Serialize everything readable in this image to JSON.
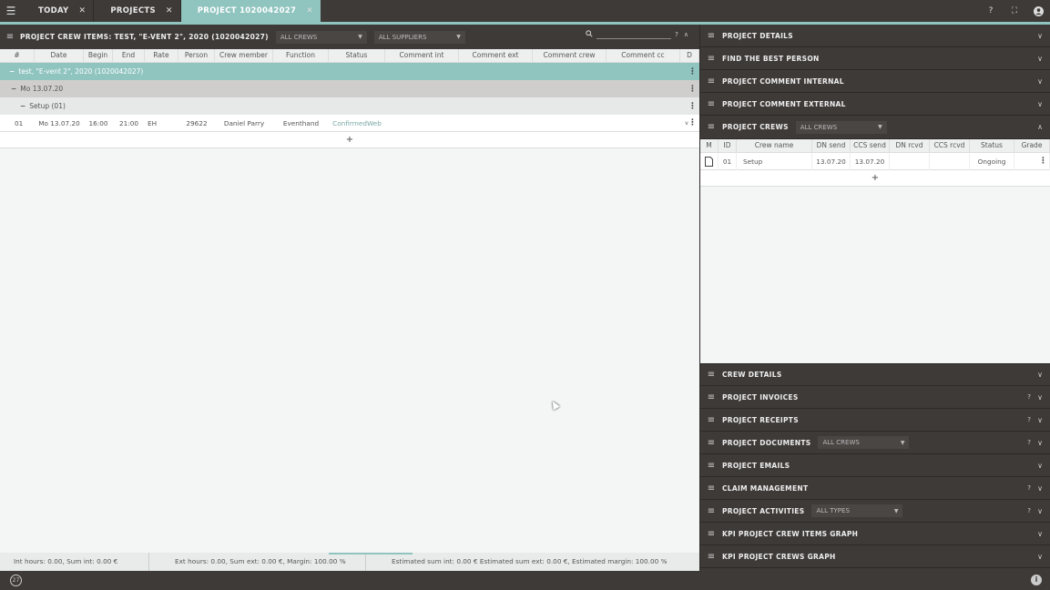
{
  "topbar": {
    "tabs": [
      {
        "label": "TODAY",
        "active": false
      },
      {
        "label": "PROJECTS",
        "active": false
      },
      {
        "label": "PROJECT 1020042027",
        "active": true
      }
    ],
    "close_glyph": "✕",
    "help": "?",
    "fullscreen_icon": "⛶",
    "user_icon": "●"
  },
  "crew_items": {
    "title": "PROJECT CREW ITEMS: TEST, \"E-VENT 2\", 2020 (1020042027)",
    "crew_filter": "ALL CREWS",
    "supplier_filter": "ALL SUPPLIERS",
    "search_help": "?",
    "columns": [
      "#",
      "Date",
      "Begin",
      "End",
      "Rate",
      "Person",
      "Crew member",
      "Function",
      "Status",
      "Comment int",
      "Comment ext",
      "Comment crew",
      "Comment cc",
      "D"
    ],
    "group_project": "test, \"E-vent 2\", 2020 (1020042027)",
    "group_date": "Mo 13.07.20",
    "group_crew": "Setup (01)",
    "rows": [
      {
        "num": "01",
        "date": "Mo 13.07.20",
        "begin": "16:00",
        "end": "21:00",
        "rate": "EH",
        "person": "29622",
        "crew_member": "Daniel Parry",
        "function": "Eventhand",
        "status": "ConfirmedWeb",
        "comment_int": "",
        "comment_ext": "",
        "comment_crew": "",
        "comment_cc": "",
        "d": "v"
      }
    ],
    "add_label": "+"
  },
  "footer": {
    "int": "Int hours: 0.00, Sum int: 0.00 €",
    "ext": "Ext hours: 0.00, Sum ext: 0.00 €, Margin: 100.00 %",
    "estimated": "Estimated sum int: 0.00 € Estimated sum ext: 0.00 €, Estimated margin: 100.00 %"
  },
  "right": {
    "top_sections": [
      "PROJECT DETAILS",
      "FIND THE BEST PERSON",
      "PROJECT COMMENT INTERNAL",
      "PROJECT COMMENT EXTERNAL"
    ],
    "crews": {
      "title": "PROJECT CREWS",
      "filter": "ALL CREWS",
      "columns": [
        "M",
        "ID",
        "Crew name",
        "DN send",
        "CCS send",
        "DN rcvd",
        "CCS rcvd",
        "Status",
        "Grade"
      ],
      "rows": [
        {
          "id": "01",
          "name": "Setup",
          "dn_send": "13.07.20",
          "ccs_send": "13.07.20",
          "dn_rcvd": "",
          "ccs_rcvd": "",
          "status": "Ongoing",
          "grade": ""
        }
      ],
      "add_label": "+"
    },
    "crew_details": "CREW DETAILS",
    "invoices": "PROJECT INVOICES",
    "receipts": "PROJECT RECEIPTS",
    "documents": {
      "title": "PROJECT DOCUMENTS",
      "filter": "ALL CREWS"
    },
    "emails": "PROJECT EMAILS",
    "claims": "CLAIM MANAGEMENT",
    "activities": {
      "title": "PROJECT ACTIVITIES",
      "filter": "ALL TYPES"
    },
    "kpi_items": "KPI PROJECT CREW ITEMS GRAPH",
    "kpi_crews": "KPI PROJECT CREWS GRAPH",
    "help": "?"
  },
  "bottombar": {
    "badge": "27",
    "info": "i"
  },
  "colors": {
    "accent": "#8fc4bf",
    "dark": "#3e3a38"
  }
}
